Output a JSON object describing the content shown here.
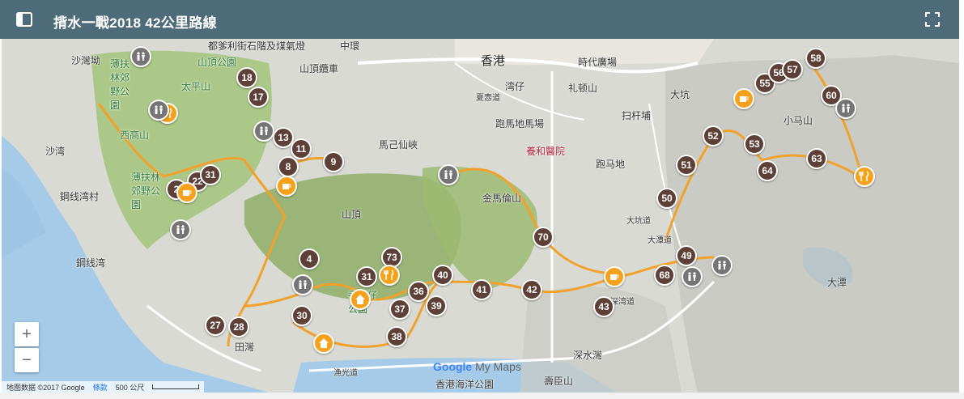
{
  "header": {
    "title": "揹水一戰2018 42公里路線"
  },
  "map": {
    "place_labels": [
      {
        "id": "p1",
        "text": "都爹利街石階及煤氣燈"
      },
      {
        "id": "p2",
        "text": "中環"
      },
      {
        "id": "p3",
        "text": "香港"
      },
      {
        "id": "p4",
        "text": "時代廣場"
      },
      {
        "id": "p5",
        "text": "山頂纜車"
      },
      {
        "id": "p6",
        "text": "沙灣坳"
      },
      {
        "id": "p7",
        "text": "薄扶林郊野公園"
      },
      {
        "id": "p8",
        "text": "山頂公園"
      },
      {
        "id": "p9",
        "text": "太平山"
      },
      {
        "id": "p10",
        "text": "西高山"
      },
      {
        "id": "p11",
        "text": "薄扶林郊野公園"
      },
      {
        "id": "p12",
        "text": "鋼线湾村"
      },
      {
        "id": "p13",
        "text": "鋼线湾"
      },
      {
        "id": "p14",
        "text": "沙湾"
      },
      {
        "id": "p15",
        "text": "馬己仙峽"
      },
      {
        "id": "p16",
        "text": "山頂"
      },
      {
        "id": "p17",
        "text": "金馬倫山"
      },
      {
        "id": "p18",
        "text": "跑馬地馬場"
      },
      {
        "id": "p19",
        "text": "養和醫院"
      },
      {
        "id": "p20",
        "text": "跑马地"
      },
      {
        "id": "p21",
        "text": "湾仔"
      },
      {
        "id": "p22",
        "text": "礼顿山"
      },
      {
        "id": "p23",
        "text": "扫杆埔"
      },
      {
        "id": "p24",
        "text": "大坑"
      },
      {
        "id": "p25",
        "text": "大坑道"
      },
      {
        "id": "p26",
        "text": "小马山"
      },
      {
        "id": "p27",
        "text": "大潭"
      },
      {
        "id": "p28",
        "text": "深水灣"
      },
      {
        "id": "p29",
        "text": "香港海洋公園"
      },
      {
        "id": "p30",
        "text": "壽臣山"
      },
      {
        "id": "p31",
        "text": "田灣"
      },
      {
        "id": "p32",
        "text": "香港仔公園"
      },
      {
        "id": "p33",
        "text": "漁光道"
      },
      {
        "id": "p34",
        "text": "夏悫道"
      },
      {
        "id": "p35",
        "text": "大潭道"
      },
      {
        "id": "p36",
        "text": "深湾道"
      }
    ],
    "markers": [
      "18",
      "17",
      "13",
      "11",
      "9",
      "8",
      "22",
      "31",
      "2",
      "4",
      "31",
      "73",
      "36",
      "40",
      "41",
      "42",
      "37",
      "39",
      "38",
      "30",
      "27",
      "28",
      "70",
      "43",
      "68",
      "49",
      "50",
      "51",
      "52",
      "53",
      "64",
      "63",
      "58",
      "55",
      "56",
      "57",
      "60"
    ],
    "zoom_in": "+",
    "zoom_out": "−",
    "logo_google": "Google",
    "logo_mymaps": "My Maps",
    "footer": {
      "data": "地图数据 ©2017 Google",
      "terms": "條款",
      "scale": "500 公尺"
    }
  }
}
